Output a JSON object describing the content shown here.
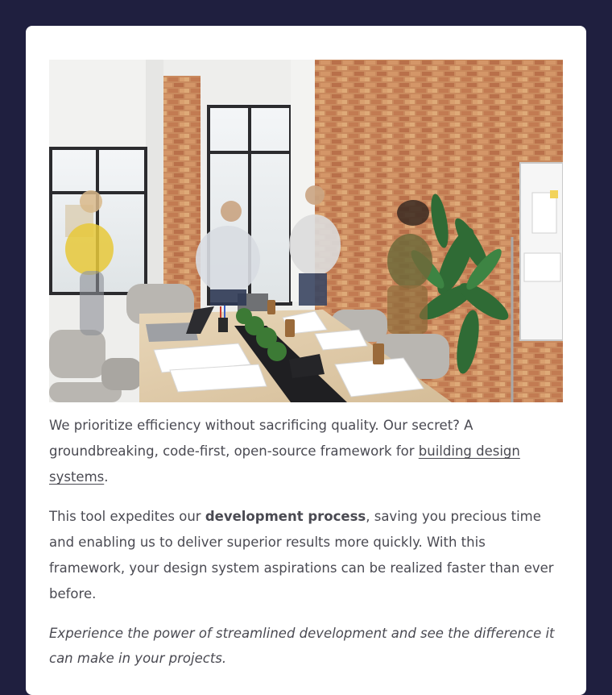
{
  "article": {
    "hero_image": {
      "alt": "Office team working in a bright brick-walled meeting room"
    },
    "paragraph1": {
      "before_link": "We prioritize efficiency without sacrificing quality. Our secret? A groundbreaking, code-first, open-source framework for ",
      "link_text": "building design systems",
      "after_link": "."
    },
    "paragraph2": {
      "before_bold": "This tool expedites our ",
      "bold_text": "development process",
      "after_bold": ", saving you precious time and enabling us to deliver superior results more quickly. With this framework, your design system aspirations can be realized faster than ever before."
    },
    "paragraph3": {
      "text": "Experience the power of streamlined development and see the difference it can make in your projects."
    }
  },
  "colors": {
    "page_background": "#1f1f3f",
    "card_background": "#ffffff",
    "text": "#4a4a52"
  }
}
